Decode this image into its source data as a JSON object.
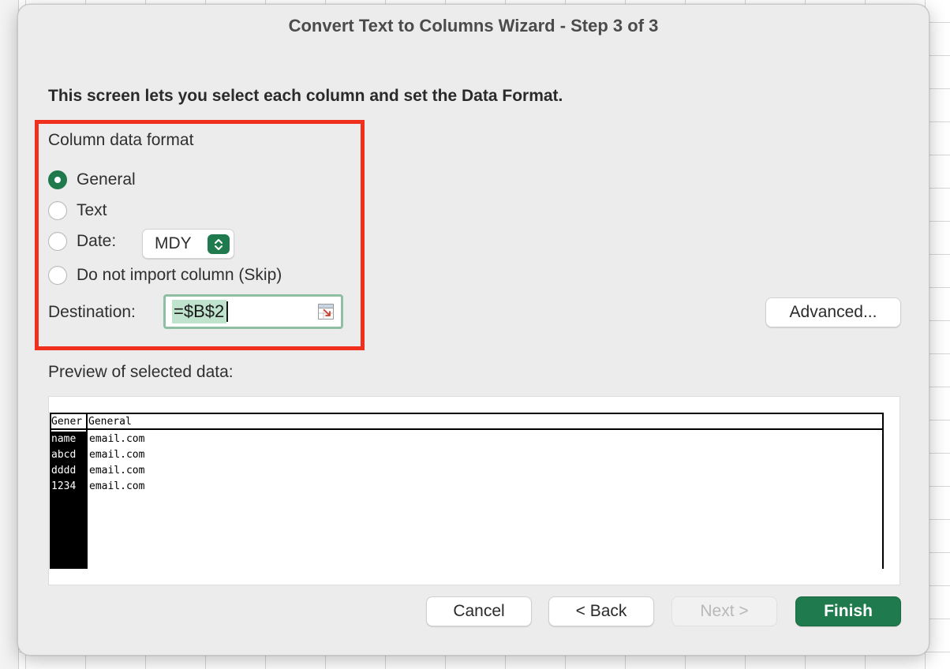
{
  "dialog": {
    "title": "Convert Text to Columns Wizard - Step 3 of 3",
    "instruction": "This screen lets you select each column and set the Data Format."
  },
  "format": {
    "group_label": "Column data format",
    "options": [
      {
        "label": "General",
        "checked": true
      },
      {
        "label": "Text",
        "checked": false
      },
      {
        "label": "Date:",
        "checked": false
      },
      {
        "label": "Do not import column (Skip)",
        "checked": false
      }
    ],
    "date_order": "MDY",
    "destination_label": "Destination:",
    "destination_value": "=$B$2"
  },
  "advanced_label": "Advanced...",
  "preview": {
    "label": "Preview of selected data:",
    "headers": [
      "Gener",
      "General"
    ],
    "rows": [
      [
        "name",
        "email.com"
      ],
      [
        "abcd",
        "email.com"
      ],
      [
        "dddd",
        "email.com"
      ],
      [
        "1234",
        "email.com"
      ]
    ]
  },
  "buttons": {
    "cancel": "Cancel",
    "back": "< Back",
    "next": "Next >",
    "finish": "Finish"
  },
  "colors": {
    "accent": "#1f7a4d",
    "highlight_box": "#f0301c"
  }
}
